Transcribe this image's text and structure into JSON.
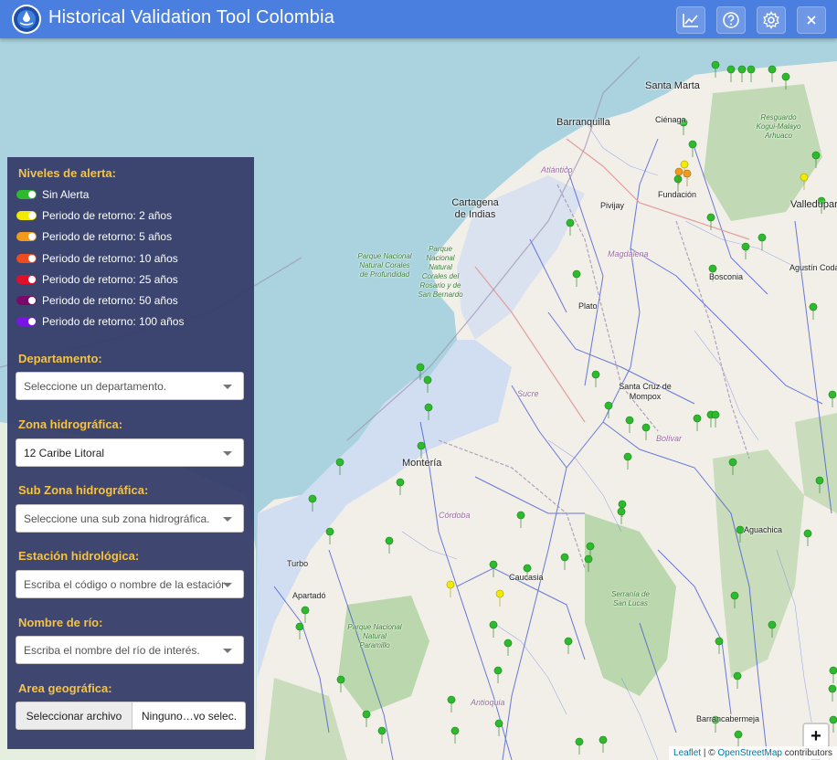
{
  "header": {
    "title": "Historical Validation Tool Colombia",
    "buttons": [
      "chart",
      "help",
      "settings",
      "close"
    ]
  },
  "colors": {
    "header_bg": "#4a7fe0",
    "panel_bg": "#343c68",
    "label_color": "#f6c342",
    "sea": "#aad3df",
    "land": "#f2efe9"
  },
  "legend": {
    "title": "Niveles de alerta:",
    "items": [
      {
        "label": "Sin Alerta",
        "color": "#2dbb2d"
      },
      {
        "label": "Periodo de retorno: 2 años",
        "color": "#f2ea00"
      },
      {
        "label": "Periodo de retorno: 5 años",
        "color": "#f29a1c"
      },
      {
        "label": "Periodo de retorno: 10 años",
        "color": "#ee4b1f"
      },
      {
        "label": "Periodo de retorno: 25 años",
        "color": "#e0102b"
      },
      {
        "label": "Periodo de retorno: 50 años",
        "color": "#7a0a6a"
      },
      {
        "label": "Periodo de retorno: 100 años",
        "color": "#7b14e6"
      }
    ]
  },
  "filters": {
    "departamento": {
      "label": "Departamento:",
      "placeholder": "Seleccione un departamento."
    },
    "zona": {
      "label": "Zona hidrográfica:",
      "value": "12 Caribe Litoral"
    },
    "subzona": {
      "label": "Sub Zona hidrográfica:",
      "placeholder": "Seleccione una sub zona hidrográfica."
    },
    "estacion": {
      "label": "Estación hidrológica:",
      "placeholder": "Escriba el código o nombre de la estación."
    },
    "rio": {
      "label": "Nombre de río:",
      "placeholder": "Escriba el nombre del río de interés."
    },
    "area": {
      "label": "Area geográfica:",
      "button": "Seleccionar archivo",
      "status": "Ninguno…vo selec."
    }
  },
  "map": {
    "zoom_in": "+",
    "zoom_out": "−",
    "attribution": {
      "leaflet": "Leaflet",
      "sep": " | © ",
      "osm": "OpenStreetMap",
      "tail": " contributors"
    },
    "labels": [
      {
        "text": "Santa Marta",
        "kind": "city"
      },
      {
        "text": "Barranquilla",
        "kind": "city"
      },
      {
        "text": "Ciénaga",
        "kind": "city"
      },
      {
        "text": "Cartagena de Indias",
        "kind": "city"
      },
      {
        "text": "Valledupar",
        "kind": "city"
      },
      {
        "text": "Fundación",
        "kind": "city"
      },
      {
        "text": "Plato",
        "kind": "city"
      },
      {
        "text": "Pivijay",
        "kind": "city"
      },
      {
        "text": "Santa Cruz de Mompox",
        "kind": "city"
      },
      {
        "text": "Montería",
        "kind": "city"
      },
      {
        "text": "Caucasia",
        "kind": "city"
      },
      {
        "text": "Aguachica",
        "kind": "city"
      },
      {
        "text": "Turbo",
        "kind": "city"
      },
      {
        "text": "Apartadó",
        "kind": "city"
      },
      {
        "text": "Agustín Codazzi",
        "kind": "city"
      },
      {
        "text": "Barrancabermeja",
        "kind": "city"
      },
      {
        "text": "Bosconia",
        "kind": "city"
      },
      {
        "text": "Magdalena",
        "kind": "muni"
      },
      {
        "text": "Bolívar",
        "kind": "muni"
      },
      {
        "text": "Sucre",
        "kind": "muni"
      },
      {
        "text": "Córdoba",
        "kind": "muni"
      },
      {
        "text": "Antioquia",
        "kind": "muni"
      },
      {
        "text": "Atlántico",
        "kind": "muni"
      },
      {
        "text": "Parque Nacional Natural Corales de Profundidad",
        "kind": "park"
      },
      {
        "text": "Parque Nacional Natural Corales del Rosario y de San Bernardo",
        "kind": "park"
      },
      {
        "text": "Parque Nacional Natural Paramillo",
        "kind": "park"
      },
      {
        "text": "Resguardo Kogui-Malayo Arhuaco",
        "kind": "park"
      },
      {
        "text": "Serranía de San Lucas",
        "kind": "park"
      }
    ]
  }
}
